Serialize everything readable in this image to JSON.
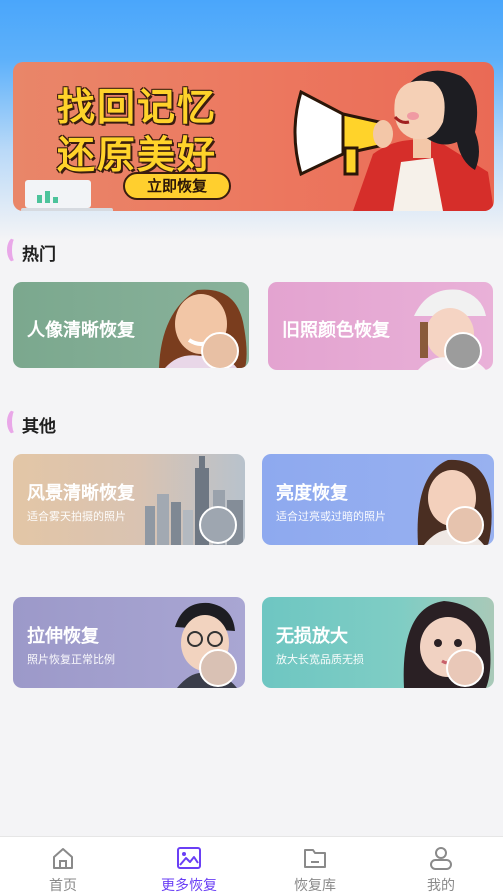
{
  "banner": {
    "line1": "找回记忆",
    "line2": "还原美好",
    "button": "立即恢复"
  },
  "sections": {
    "hot": "热门",
    "other": "其他"
  },
  "hot_cards": [
    {
      "title": "人像清晰恢复"
    },
    {
      "title": "旧照颜色恢复"
    }
  ],
  "other_cards": [
    {
      "title": "风景清晰恢复",
      "subtitle": "适合雾天拍摄的照片"
    },
    {
      "title": "亮度恢复",
      "subtitle": "适合过亮或过暗的照片"
    },
    {
      "title": "拉伸恢复",
      "subtitle": "照片恢复正常比例"
    },
    {
      "title": "无损放大",
      "subtitle": "放大长宽品质无损"
    }
  ],
  "tabbar": {
    "items": [
      {
        "label": "首页",
        "icon": "home-icon"
      },
      {
        "label": "更多恢复",
        "icon": "image-icon"
      },
      {
        "label": "恢复库",
        "icon": "folder-icon"
      },
      {
        "label": "我的",
        "icon": "person-icon"
      }
    ],
    "active_index": 1,
    "active_color": "#6a3ff5"
  }
}
